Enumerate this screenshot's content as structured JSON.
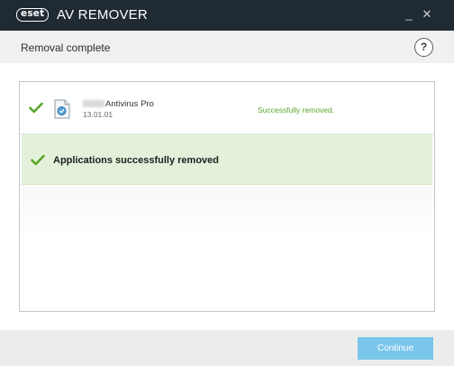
{
  "window": {
    "brand": "eset",
    "title": "AV REMOVER",
    "minimize_label": "_",
    "close_label": "✕"
  },
  "header": {
    "title": "Removal complete",
    "help_label": "?"
  },
  "results": {
    "app": {
      "name": "Antivirus Pro",
      "version": "13.01.01",
      "status": "Successfully removed.",
      "status_color": "#5aa62a"
    },
    "summary": "Applications successfully removed"
  },
  "footer": {
    "continue_label": "Continue",
    "accent_color": "#79c6ea"
  },
  "colors": {
    "titlebar": "#1f2a32",
    "success_green": "#5aa62a",
    "summary_bg": "#e3f1da"
  },
  "icons": {
    "app_icon": "document-shield-icon",
    "success": "checkmark-icon",
    "help": "question-circle-icon"
  }
}
